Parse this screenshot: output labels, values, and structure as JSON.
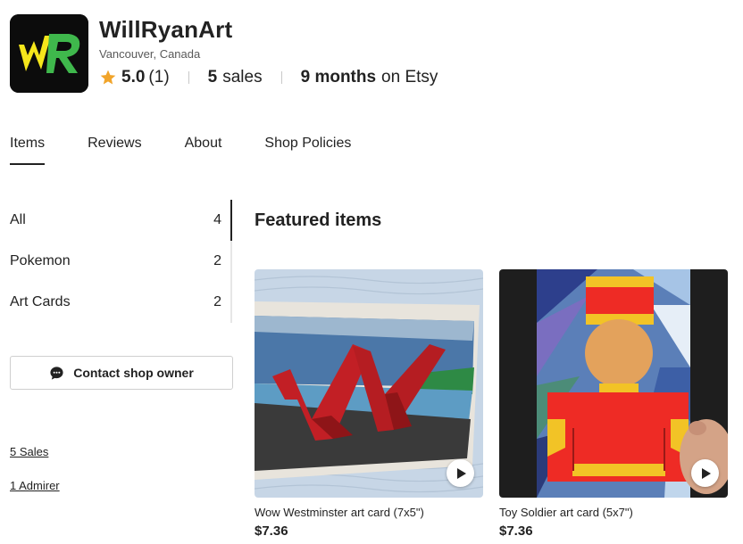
{
  "shop": {
    "logo_text": "WR",
    "name": "WillRyanArt",
    "location": "Vancouver, Canada",
    "rating": "5.0",
    "review_count": "(1)",
    "sales_count": "5",
    "sales_label": "sales",
    "tenure_value": "9 months",
    "tenure_label": "on Etsy",
    "star_color": "#f1a42a"
  },
  "tabs": [
    {
      "label": "Items",
      "active": true
    },
    {
      "label": "Reviews",
      "active": false
    },
    {
      "label": "About",
      "active": false
    },
    {
      "label": "Shop Policies",
      "active": false
    }
  ],
  "categories": [
    {
      "label": "All",
      "count": "4",
      "active": true
    },
    {
      "label": "Pokemon",
      "count": "2",
      "active": false
    },
    {
      "label": "Art Cards",
      "count": "2",
      "active": false
    }
  ],
  "contact": {
    "label": "Contact shop owner",
    "icon": "chat-bubble-icon"
  },
  "sidebar_links": {
    "sales": "5 Sales",
    "admirers": "1 Admirer"
  },
  "featured": {
    "title": "Featured items",
    "items": [
      {
        "title": "Wow Westminster art card (7x5\")",
        "price": "$7.36",
        "has_video": true
      },
      {
        "title": "Toy Soldier art card (5x7\")",
        "price": "$7.36",
        "has_video": true
      }
    ]
  }
}
